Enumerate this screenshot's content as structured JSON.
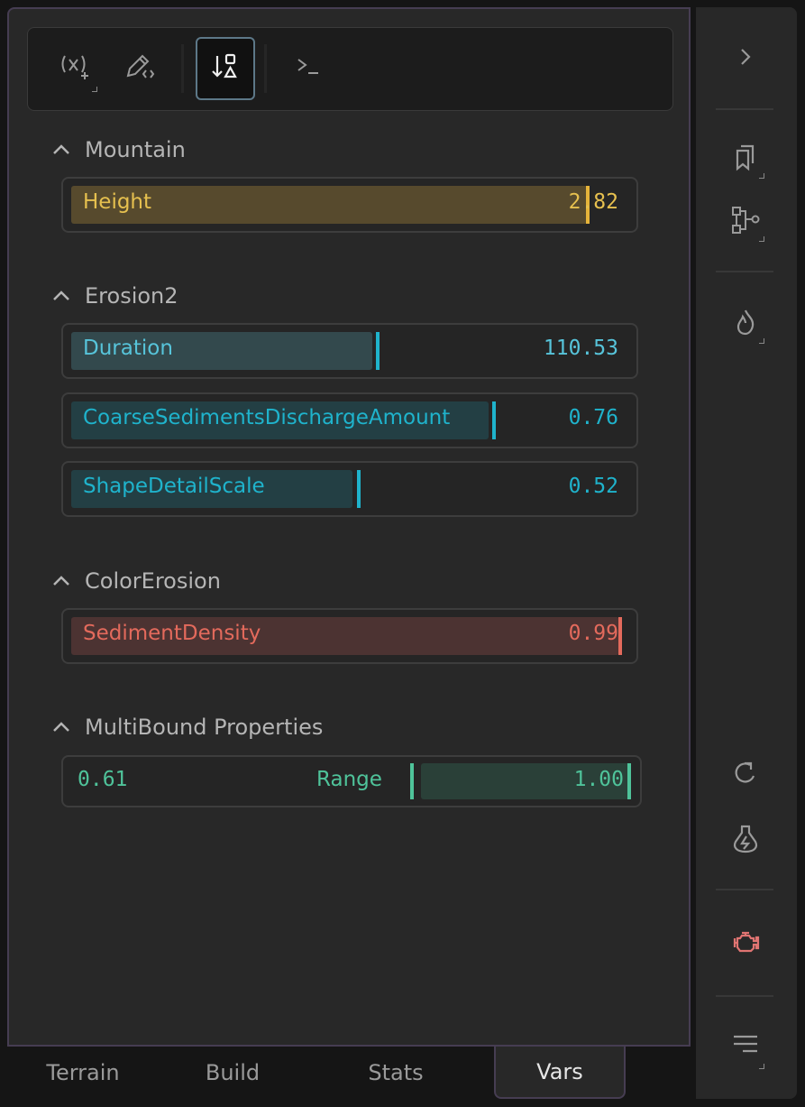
{
  "toolbar": {
    "buttons": [
      {
        "icon": "variable-add-icon"
      },
      {
        "icon": "edit-code-icon"
      },
      {
        "icon": "sort-shapes-icon",
        "active": true
      },
      {
        "icon": "terminal-icon"
      }
    ]
  },
  "sections": [
    {
      "title": "Mountain",
      "fields": [
        {
          "label": "Height",
          "value": "2.82",
          "fraction": 0.89,
          "color": "#e6c04f",
          "fill": "#574a2d"
        }
      ]
    },
    {
      "title": "Erosion2",
      "fields": [
        {
          "label": "Duration",
          "value": "110.53",
          "fraction": 0.55,
          "color": "#57c4da",
          "fill": "#33494d"
        },
        {
          "label": "CoarseSedimentsDischargeAmount",
          "value": "0.76",
          "fraction": 0.76,
          "color": "#1fb3cc",
          "fill": "#233f44"
        },
        {
          "label": "ShapeDetailScale",
          "value": "0.52",
          "fraction": 0.52,
          "color": "#1fb3cc",
          "fill": "#233f44"
        }
      ]
    },
    {
      "title": "ColorErosion",
      "fields": [
        {
          "label": "SedimentDensity",
          "value": "0.99",
          "fraction": 0.99,
          "color": "#e36a5c",
          "fill": "#4c3332"
        }
      ]
    },
    {
      "title": "MultiBound Properties",
      "range": {
        "low": "0.61",
        "label": "Range",
        "high": "1.00",
        "color": "#4fc39a",
        "fill": "#2a4038"
      }
    }
  ],
  "sidebar": {
    "icons": [
      "chevron-right-icon",
      "bookmarks-icon",
      "flow-graph-icon",
      "flame-icon",
      "redo-icon",
      "flask-icon",
      "engine-icon",
      "menu-lines-icon"
    ]
  },
  "tabs": [
    "Terrain",
    "Build",
    "Stats",
    "Vars"
  ],
  "active_tab": "Vars"
}
